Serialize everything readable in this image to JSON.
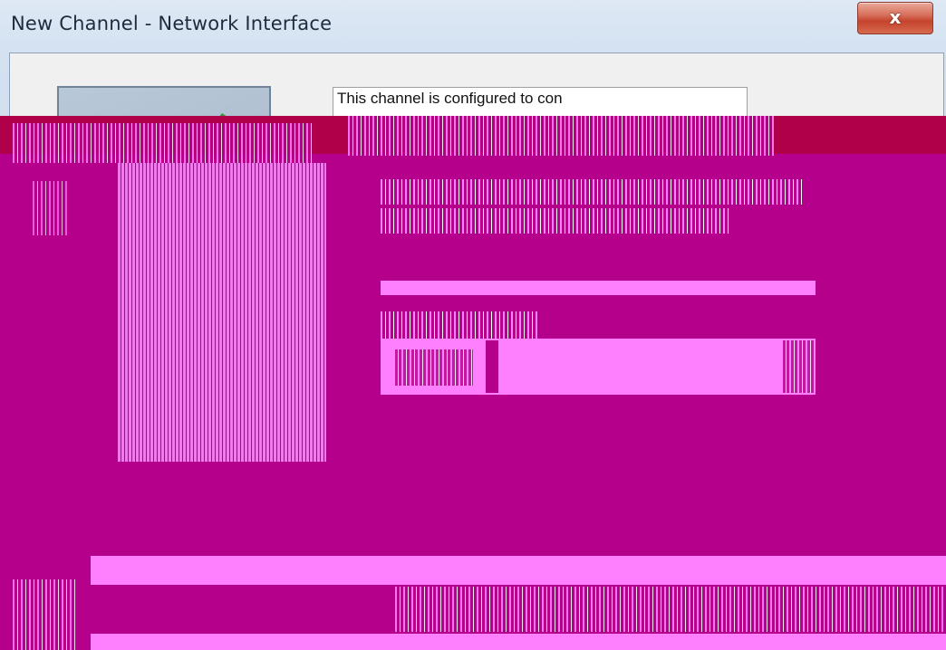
{
  "window": {
    "title": "New Channel - Network Interface",
    "close_label": "x"
  },
  "info": {
    "text": "This channel is configured to con"
  },
  "colors": {
    "corruption_magenta": "#b4008a",
    "corruption_pink": "#ff80ff",
    "corruption_red": "#b0004a"
  }
}
